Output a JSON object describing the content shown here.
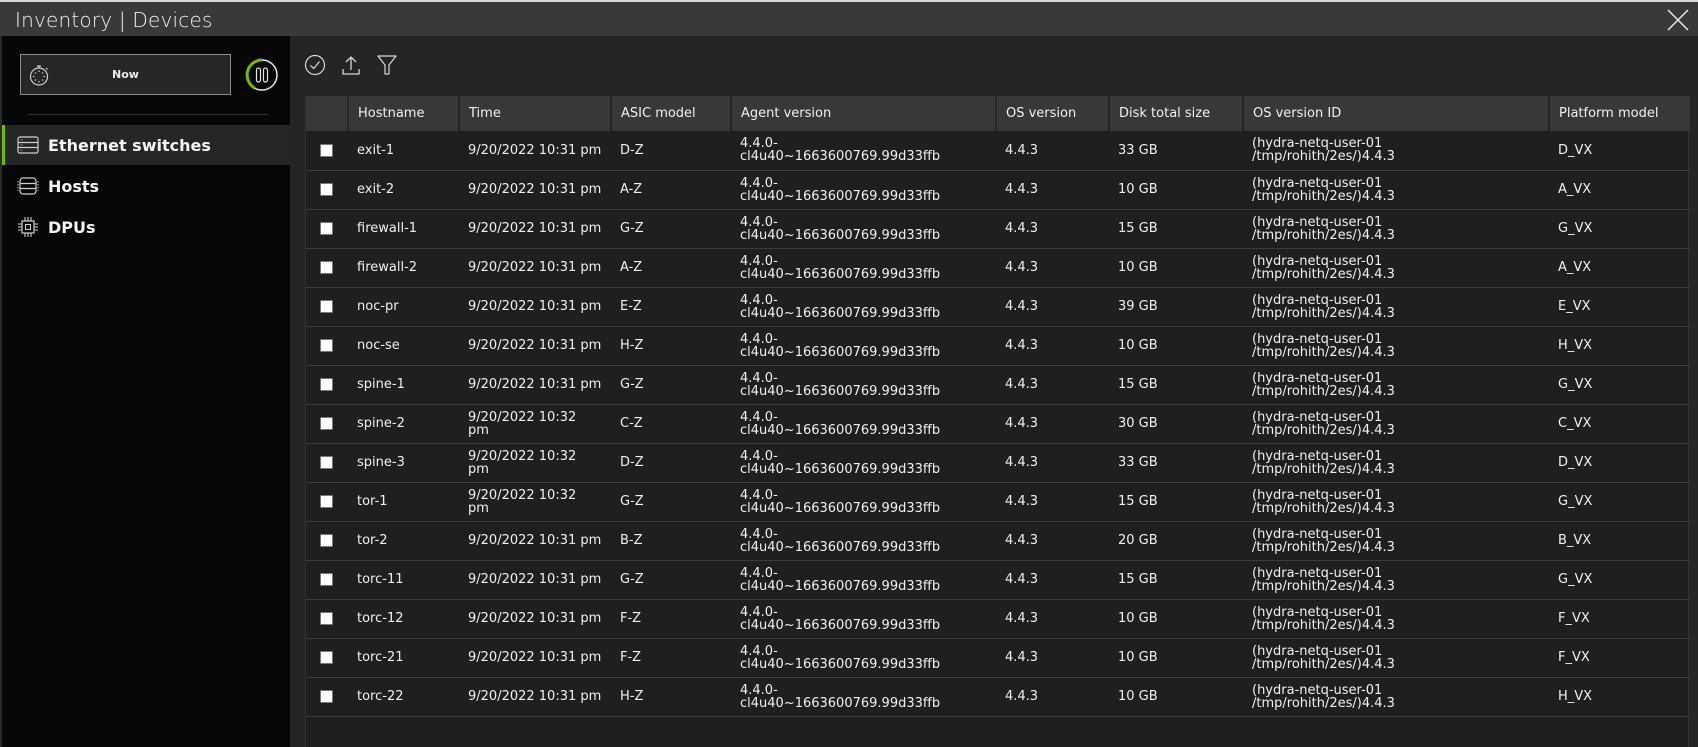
{
  "window": {
    "title": "Inventory | Devices",
    "close_icon": "close-icon"
  },
  "sidebar": {
    "time_picker": {
      "label": "Now",
      "icon": "stopwatch-icon"
    },
    "pause_icon": "pause-icon",
    "accent_color": "#76b900",
    "items": [
      {
        "label": "Ethernet switches",
        "icon": "switch-icon",
        "active": true
      },
      {
        "label": "Hosts",
        "icon": "server-icon",
        "active": false
      },
      {
        "label": "DPUs",
        "icon": "chip-icon",
        "active": false
      }
    ]
  },
  "toolbar": {
    "select_icon": "check-circle-icon",
    "export_icon": "upload-icon",
    "filter_icon": "filter-icon"
  },
  "table": {
    "columns": [
      "Hostname",
      "Time",
      "ASIC model",
      "Agent version",
      "OS version",
      "Disk total size",
      "OS version ID",
      "Platform model"
    ],
    "rows": [
      {
        "hostname": "exit-1",
        "time1": "9/20/2022 10:31 pm",
        "time2": "",
        "asic": "D-Z",
        "agent1": "4.4.0-",
        "agent2": "cl4u40~1663600769.99d33ffb",
        "os": "4.4.3",
        "disk": "33 GB",
        "osid1": "(hydra-netq-user-01",
        "osid2": "/tmp/rohith/2es/)4.4.3",
        "platform": "D_VX"
      },
      {
        "hostname": "exit-2",
        "time1": "9/20/2022 10:31 pm",
        "time2": "",
        "asic": "A-Z",
        "agent1": "4.4.0-",
        "agent2": "cl4u40~1663600769.99d33ffb",
        "os": "4.4.3",
        "disk": "10 GB",
        "osid1": "(hydra-netq-user-01",
        "osid2": "/tmp/rohith/2es/)4.4.3",
        "platform": "A_VX"
      },
      {
        "hostname": "firewall-1",
        "time1": "9/20/2022 10:31 pm",
        "time2": "",
        "asic": "G-Z",
        "agent1": "4.4.0-",
        "agent2": "cl4u40~1663600769.99d33ffb",
        "os": "4.4.3",
        "disk": "15 GB",
        "osid1": "(hydra-netq-user-01",
        "osid2": "/tmp/rohith/2es/)4.4.3",
        "platform": "G_VX"
      },
      {
        "hostname": "firewall-2",
        "time1": "9/20/2022 10:31 pm",
        "time2": "",
        "asic": "A-Z",
        "agent1": "4.4.0-",
        "agent2": "cl4u40~1663600769.99d33ffb",
        "os": "4.4.3",
        "disk": "10 GB",
        "osid1": "(hydra-netq-user-01",
        "osid2": "/tmp/rohith/2es/)4.4.3",
        "platform": "A_VX"
      },
      {
        "hostname": "noc-pr",
        "time1": "9/20/2022 10:31 pm",
        "time2": "",
        "asic": "E-Z",
        "agent1": "4.4.0-",
        "agent2": "cl4u40~1663600769.99d33ffb",
        "os": "4.4.3",
        "disk": "39 GB",
        "osid1": "(hydra-netq-user-01",
        "osid2": "/tmp/rohith/2es/)4.4.3",
        "platform": "E_VX"
      },
      {
        "hostname": "noc-se",
        "time1": "9/20/2022 10:31 pm",
        "time2": "",
        "asic": "H-Z",
        "agent1": "4.4.0-",
        "agent2": "cl4u40~1663600769.99d33ffb",
        "os": "4.4.3",
        "disk": "10 GB",
        "osid1": "(hydra-netq-user-01",
        "osid2": "/tmp/rohith/2es/)4.4.3",
        "platform": "H_VX"
      },
      {
        "hostname": "spine-1",
        "time1": "9/20/2022 10:31 pm",
        "time2": "",
        "asic": "G-Z",
        "agent1": "4.4.0-",
        "agent2": "cl4u40~1663600769.99d33ffb",
        "os": "4.4.3",
        "disk": "15 GB",
        "osid1": "(hydra-netq-user-01",
        "osid2": "/tmp/rohith/2es/)4.4.3",
        "platform": "G_VX"
      },
      {
        "hostname": "spine-2",
        "time1": "9/20/2022 10:32",
        "time2": "pm",
        "asic": "C-Z",
        "agent1": "4.4.0-",
        "agent2": "cl4u40~1663600769.99d33ffb",
        "os": "4.4.3",
        "disk": "30 GB",
        "osid1": "(hydra-netq-user-01",
        "osid2": "/tmp/rohith/2es/)4.4.3",
        "platform": "C_VX"
      },
      {
        "hostname": "spine-3",
        "time1": "9/20/2022 10:32",
        "time2": "pm",
        "asic": "D-Z",
        "agent1": "4.4.0-",
        "agent2": "cl4u40~1663600769.99d33ffb",
        "os": "4.4.3",
        "disk": "33 GB",
        "osid1": "(hydra-netq-user-01",
        "osid2": "/tmp/rohith/2es/)4.4.3",
        "platform": "D_VX"
      },
      {
        "hostname": "tor-1",
        "time1": "9/20/2022 10:32",
        "time2": "pm",
        "asic": "G-Z",
        "agent1": "4.4.0-",
        "agent2": "cl4u40~1663600769.99d33ffb",
        "os": "4.4.3",
        "disk": "15 GB",
        "osid1": "(hydra-netq-user-01",
        "osid2": "/tmp/rohith/2es/)4.4.3",
        "platform": "G_VX"
      },
      {
        "hostname": "tor-2",
        "time1": "9/20/2022 10:31 pm",
        "time2": "",
        "asic": "B-Z",
        "agent1": "4.4.0-",
        "agent2": "cl4u40~1663600769.99d33ffb",
        "os": "4.4.3",
        "disk": "20 GB",
        "osid1": "(hydra-netq-user-01",
        "osid2": "/tmp/rohith/2es/)4.4.3",
        "platform": "B_VX"
      },
      {
        "hostname": "torc-11",
        "time1": "9/20/2022 10:31 pm",
        "time2": "",
        "asic": "G-Z",
        "agent1": "4.4.0-",
        "agent2": "cl4u40~1663600769.99d33ffb",
        "os": "4.4.3",
        "disk": "15 GB",
        "osid1": "(hydra-netq-user-01",
        "osid2": "/tmp/rohith/2es/)4.4.3",
        "platform": "G_VX"
      },
      {
        "hostname": "torc-12",
        "time1": "9/20/2022 10:31 pm",
        "time2": "",
        "asic": "F-Z",
        "agent1": "4.4.0-",
        "agent2": "cl4u40~1663600769.99d33ffb",
        "os": "4.4.3",
        "disk": "10 GB",
        "osid1": "(hydra-netq-user-01",
        "osid2": "/tmp/rohith/2es/)4.4.3",
        "platform": "F_VX"
      },
      {
        "hostname": "torc-21",
        "time1": "9/20/2022 10:31 pm",
        "time2": "",
        "asic": "F-Z",
        "agent1": "4.4.0-",
        "agent2": "cl4u40~1663600769.99d33ffb",
        "os": "4.4.3",
        "disk": "10 GB",
        "osid1": "(hydra-netq-user-01",
        "osid2": "/tmp/rohith/2es/)4.4.3",
        "platform": "F_VX"
      },
      {
        "hostname": "torc-22",
        "time1": "9/20/2022 10:31 pm",
        "time2": "",
        "asic": "H-Z",
        "agent1": "4.4.0-",
        "agent2": "cl4u40~1663600769.99d33ffb",
        "os": "4.4.3",
        "disk": "10 GB",
        "osid1": "(hydra-netq-user-01",
        "osid2": "/tmp/rohith/2es/)4.4.3",
        "platform": "H_VX"
      }
    ]
  }
}
